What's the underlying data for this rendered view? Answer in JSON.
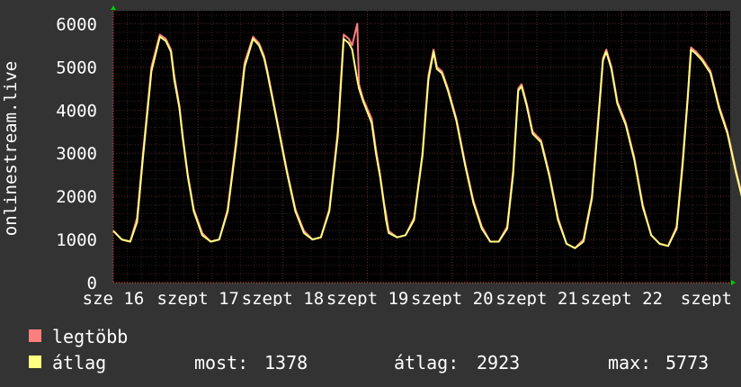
{
  "chart_data": {
    "type": "line",
    "ylabel": "onlinestream.live",
    "ylim": [
      0,
      6300
    ],
    "yticks": [
      "0",
      "1000",
      "2000",
      "3000",
      "4000",
      "5000",
      "6000"
    ],
    "xticks": [
      "sze 16",
      "szept 17",
      "szept 18",
      "szept 19",
      "szept 20",
      "szept 21",
      "szept 22",
      "szept"
    ],
    "x_unit": "day",
    "x_range": [
      0,
      7.93
    ],
    "grid": true,
    "background": "#000000",
    "grid_color": "#5a2a2a",
    "series": [
      {
        "name": "legtöbb",
        "color": "#ff7f7f",
        "x": [
          0,
          0.1,
          0.2,
          0.28,
          0.35,
          0.45,
          0.55,
          0.62,
          0.68,
          0.72,
          0.78,
          0.82,
          0.88,
          0.95,
          1.05,
          1.15,
          1.25,
          1.35,
          1.45,
          1.55,
          1.65,
          1.72,
          1.78,
          1.82,
          1.88,
          1.95,
          2.05,
          2.15,
          2.25,
          2.35,
          2.45,
          2.55,
          2.65,
          2.72,
          2.78,
          2.82,
          2.88,
          2.9,
          2.95,
          3.05,
          3.1,
          3.15,
          3.2,
          3.22,
          3.25,
          3.35,
          3.45,
          3.55,
          3.65,
          3.72,
          3.78,
          3.82,
          3.88,
          3.95,
          4.05,
          4.15,
          4.25,
          4.35,
          4.45,
          4.55,
          4.65,
          4.72,
          4.78,
          4.82,
          4.88,
          4.95,
          5.05,
          5.15,
          5.25,
          5.35,
          5.45,
          5.55,
          5.65,
          5.72,
          5.78,
          5.82,
          5.88,
          5.95,
          6.05,
          6.15,
          6.25,
          6.35,
          6.45,
          6.55,
          6.65,
          6.72,
          6.78,
          6.82,
          6.88,
          6.95,
          7.05,
          7.15,
          7.25,
          7.35,
          7.45,
          7.55,
          7.6
        ],
        "values": [
          1200,
          1000,
          950,
          1500,
          3000,
          5000,
          5750,
          5650,
          5400,
          4800,
          4100,
          3400,
          2500,
          1700,
          1150,
          950,
          1000,
          1700,
          3300,
          5100,
          5700,
          5550,
          5250,
          4900,
          4300,
          3600,
          2600,
          1700,
          1200,
          1000,
          1050,
          1700,
          3500,
          5750,
          5650,
          5500,
          6000,
          4600,
          4250,
          3800,
          3100,
          2500,
          1800,
          1600,
          1200,
          1050,
          1100,
          1500,
          3000,
          4800,
          5400,
          5000,
          4900,
          4500,
          3800,
          2800,
          1900,
          1300,
          950,
          950,
          1300,
          2600,
          4500,
          4600,
          4150,
          3500,
          3300,
          2500,
          1500,
          900,
          800,
          1000,
          2000,
          3700,
          5200,
          5400,
          5000,
          4200,
          3700,
          2900,
          1800,
          1100,
          900,
          850,
          1300,
          2800,
          4300,
          5450,
          5350,
          5200,
          4900,
          4100,
          3500,
          2600,
          1800,
          1400,
          1378
        ]
      },
      {
        "name": "átlag",
        "color": "#ffff80",
        "x": [
          0,
          0.1,
          0.2,
          0.28,
          0.35,
          0.45,
          0.55,
          0.62,
          0.68,
          0.72,
          0.78,
          0.82,
          0.88,
          0.95,
          1.05,
          1.15,
          1.25,
          1.35,
          1.45,
          1.55,
          1.65,
          1.72,
          1.78,
          1.82,
          1.88,
          1.95,
          2.05,
          2.15,
          2.25,
          2.35,
          2.45,
          2.55,
          2.65,
          2.72,
          2.78,
          2.82,
          2.88,
          2.9,
          2.95,
          3.05,
          3.1,
          3.15,
          3.2,
          3.22,
          3.25,
          3.35,
          3.45,
          3.55,
          3.65,
          3.72,
          3.78,
          3.82,
          3.88,
          3.95,
          4.05,
          4.15,
          4.25,
          4.35,
          4.45,
          4.55,
          4.65,
          4.72,
          4.78,
          4.82,
          4.88,
          4.95,
          5.05,
          5.15,
          5.25,
          5.35,
          5.45,
          5.55,
          5.65,
          5.72,
          5.78,
          5.82,
          5.88,
          5.95,
          6.05,
          6.15,
          6.25,
          6.35,
          6.45,
          6.55,
          6.65,
          6.72,
          6.78,
          6.82,
          6.88,
          6.95,
          7.05,
          7.15,
          7.25,
          7.35,
          7.45,
          7.55,
          7.6
        ],
        "values": [
          1200,
          1000,
          950,
          1400,
          2900,
          4900,
          5700,
          5600,
          5350,
          4700,
          4050,
          3350,
          2450,
          1650,
          1100,
          950,
          1000,
          1650,
          3200,
          5000,
          5650,
          5500,
          5200,
          4850,
          4250,
          3550,
          2550,
          1650,
          1150,
          1000,
          1050,
          1650,
          3400,
          5650,
          5550,
          5400,
          4700,
          4500,
          4200,
          3700,
          3000,
          2450,
          1750,
          1450,
          1150,
          1050,
          1100,
          1450,
          2950,
          4700,
          5350,
          4950,
          4850,
          4450,
          3750,
          2750,
          1850,
          1250,
          950,
          950,
          1250,
          2500,
          4450,
          4550,
          4100,
          3450,
          3250,
          2450,
          1450,
          900,
          800,
          950,
          1950,
          3600,
          5150,
          5350,
          4950,
          4150,
          3650,
          2850,
          1750,
          1100,
          900,
          850,
          1250,
          2700,
          4250,
          5400,
          5300,
          5150,
          4850,
          4050,
          3450,
          2550,
          1750,
          1380,
          1378
        ]
      }
    ]
  },
  "legend": {
    "items": [
      {
        "label": "legtöbb",
        "color": "#ff7f7f"
      },
      {
        "label": "átlag",
        "color": "#ffff80"
      }
    ],
    "stats": [
      {
        "label": "most:",
        "value": "1378"
      },
      {
        "label": "átlag:",
        "value": "2923"
      },
      {
        "label": "max:",
        "value": "5773"
      }
    ]
  }
}
